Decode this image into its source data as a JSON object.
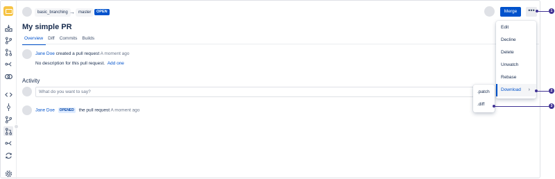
{
  "header": {
    "source_branch": "basic_branching",
    "arrow": "→",
    "target_branch": "master",
    "status": "OPEN",
    "merge_label": "Merge",
    "more_label": "•••"
  },
  "pr": {
    "title": "My simple PR",
    "tabs": [
      "Overview",
      "Diff",
      "Commits",
      "Builds"
    ]
  },
  "created_event": {
    "author": "Jane Doe",
    "action": "created a pull request",
    "time": "A moment ago",
    "description": "No description for this pull request.",
    "add_link": "Add one"
  },
  "activity": {
    "heading": "Activity",
    "comment_placeholder": "What do you want to say?",
    "event": {
      "author": "Jane Doe",
      "badge": "OPENED",
      "action": "the pull request",
      "time": "A moment ago"
    }
  },
  "more_menu": {
    "items": [
      "Edit",
      "Decline",
      "Delete",
      "Unwatch",
      "Rebase",
      "Download"
    ],
    "hovered": "Download",
    "submenu_indicator": "›"
  },
  "download_submenu": {
    "items": [
      ".patch",
      ".diff"
    ]
  },
  "callouts": [
    "1",
    "2",
    "3"
  ],
  "colors": {
    "primary": "#0052cc",
    "callout": "#403294",
    "logo": "#f6c343"
  },
  "sidebar_icons": [
    "tray-icon",
    "branch-icon",
    "pull-request-icon",
    "fork-icon",
    "compare-icon",
    "code-icon",
    "commit-icon",
    "branches-icon",
    "pull-requests-icon",
    "forks-icon",
    "pipelines-icon",
    "settings-icon"
  ]
}
